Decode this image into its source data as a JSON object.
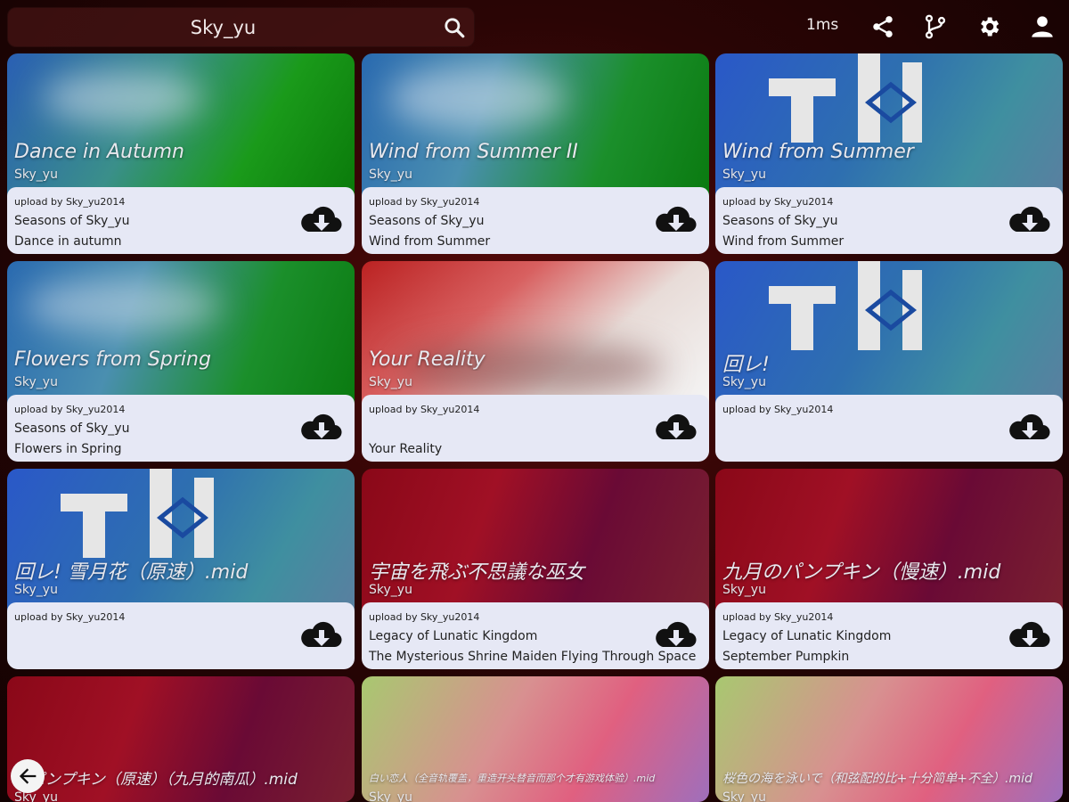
{
  "search": {
    "value": "Sky_yu"
  },
  "status": {
    "ping": "1ms"
  },
  "toolbar": {
    "icons": [
      "share-icon",
      "fork-icon",
      "gear-icon",
      "user-icon"
    ]
  },
  "cards": [
    {
      "title": "Dance in Autumn",
      "artist": "Sky_yu",
      "uploader": "upload by Sky_yu2014",
      "line1": "Seasons of Sky_yu",
      "line2": "Dance in autumn"
    },
    {
      "title": "Wind from Summer II",
      "artist": "Sky_yu",
      "uploader": "upload by Sky_yu2014",
      "line1": "Seasons of Sky_yu",
      "line2": "Wind from Summer"
    },
    {
      "title": "Wind from Summer",
      "artist": "Sky_yu",
      "uploader": "upload by Sky_yu2014",
      "line1": "Seasons of Sky_yu",
      "line2": "Wind from Summer"
    },
    {
      "title": "Flowers from Spring",
      "artist": "Sky_yu",
      "uploader": "upload by Sky_yu2014",
      "line1": "Seasons of Sky_yu",
      "line2": "Flowers in Spring"
    },
    {
      "title": "Your Reality",
      "artist": "Sky_yu",
      "uploader": "upload by Sky_yu2014",
      "line1": "",
      "line2": "Your Reality"
    },
    {
      "title": "回レ!",
      "artist": "Sky_yu",
      "uploader": "upload by Sky_yu2014",
      "line1": "",
      "line2": ""
    },
    {
      "title": "回レ! 雪月花（原速）.mid",
      "artist": "Sky_yu",
      "uploader": "upload by Sky_yu2014",
      "line1": "",
      "line2": ""
    },
    {
      "title": "宇宙を飛ぶ不思議な巫女",
      "artist": "Sky_yu",
      "uploader": "upload by Sky_yu2014",
      "line1": "Legacy of Lunatic Kingdom",
      "line2": "The Mysterious Shrine Maiden Flying Through Space"
    },
    {
      "title": "九月のパンプキン（慢速）.mid",
      "artist": "Sky_yu",
      "uploader": "upload by Sky_yu2014",
      "line1": "Legacy of Lunatic Kingdom",
      "line2": "September Pumpkin"
    },
    {
      "title": "のパンプキン（原速）（九月的南瓜）.mid",
      "artist": "Sky_yu"
    },
    {
      "title": "白い恋人（全音轨覆盖，重造开头替音而那个才有游戏体验）.mid",
      "artist": "Sky_yu"
    },
    {
      "title": "桜色の海を泳いで（和弦配的比+十分简单+不全）.mid",
      "artist": "Sky_yu"
    }
  ],
  "colors": {
    "info_bg": "#e6e8f5",
    "search_bg": "#461414",
    "page_bg": "#2a0505"
  }
}
